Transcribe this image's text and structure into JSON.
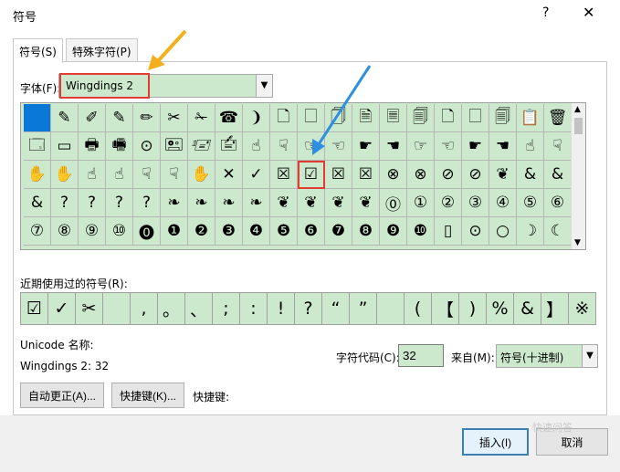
{
  "window": {
    "title": "符号",
    "help_label": "?",
    "close_label": "✕"
  },
  "tabs": [
    {
      "label": "符号(S)"
    },
    {
      "label": "特殊字符(P)"
    }
  ],
  "font": {
    "label": "字体(F):",
    "value": "Wingdings 2"
  },
  "symbol_grid": {
    "rows": [
      [
        "",
        "✎",
        "✐",
        "✎",
        "✏",
        "✂",
        "✁",
        "☎",
        "❩",
        "🗋",
        "🗌",
        "🗍",
        "🗎",
        "🗏",
        "🗐",
        "🗋",
        "🗌",
        "🗐",
        "📋",
        "🗑"
      ],
      [
        "🗔",
        "▭",
        "🖶",
        "🖷",
        "⊙",
        "🖭",
        "🖅",
        "🖆",
        "☝",
        "☟",
        "☞",
        "☜",
        "☛",
        "☚",
        "☞",
        "☜",
        "☛",
        "☚",
        "☝",
        "☟"
      ],
      [
        "✋",
        "✋",
        "☝",
        "☝",
        "☟",
        "☟",
        "✋",
        "✕",
        "✓",
        "☒",
        "☑",
        "☒",
        "☒",
        "⊗",
        "⊗",
        "⊘",
        "⊘",
        "❦",
        "&",
        "&"
      ],
      [
        "&",
        "?",
        "?",
        "?",
        "?",
        "❧",
        "❧",
        "❧",
        "❧",
        "❦",
        "❦",
        "❦",
        "❦",
        "⓪",
        "①",
        "②",
        "③",
        "④",
        "⑤",
        "⑥"
      ],
      [
        "⑦",
        "⑧",
        "⑨",
        "⑩",
        "⓿",
        "❶",
        "❷",
        "❸",
        "❹",
        "❺",
        "❻",
        "❼",
        "❽",
        "❾",
        "❿",
        "▯",
        "⊙",
        "○",
        "☽",
        "☾"
      ]
    ]
  },
  "recent": {
    "label": "近期使用过的符号(R):",
    "symbols": [
      "☑",
      "✓",
      "✂",
      "",
      ",",
      "。",
      "、",
      ";",
      ":",
      "!",
      "?",
      "“",
      "”",
      "",
      "(",
      "【",
      ")",
      "%",
      "&",
      "】",
      "※"
    ]
  },
  "unicode_name": {
    "label": "Unicode 名称:",
    "value": "Wingdings 2: 32"
  },
  "buttons": {
    "autocorrect": "自动更正(A)...",
    "shortcut_key": "快捷键(K)...",
    "shortcut_label": "快捷键:"
  },
  "char_code": {
    "label": "字符代码(C):",
    "value": "32"
  },
  "from": {
    "label": "来自(M):",
    "value": "符号(十进制)"
  },
  "footer": {
    "insert": "插入(I)",
    "cancel": "取消"
  },
  "watermark": "快速问答",
  "colors": {
    "selection_bg": "#cde9cd",
    "highlight": "#e23c30",
    "blue_arrow": "#2f8fdf",
    "orange_arrow": "#f2b01e"
  }
}
